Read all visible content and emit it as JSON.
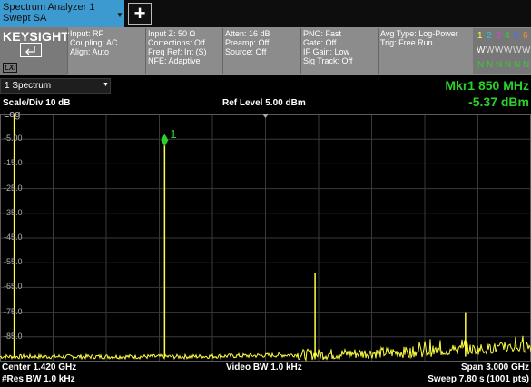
{
  "tabs": {
    "active_line1": "Spectrum Analyzer 1",
    "active_line2": "Swept SA",
    "caret": "▼",
    "add_label": "+"
  },
  "brand": {
    "name": "KEYSIGHT",
    "lxi": "LXI"
  },
  "status_columns": [
    [
      "Input: RF",
      "Coupling: AC",
      "Align: Auto"
    ],
    [
      "Input Z: 50 Ω",
      "Corrections: Off",
      "Freq Ref: Int (S)",
      "NFE: Adaptive"
    ],
    [
      "Atten: 16 dB",
      "Preamp: Off",
      "Source: Off"
    ],
    [
      "PNO: Fast",
      "Gate: Off",
      "IF Gain: Low",
      "Sig Track: Off"
    ],
    [
      "Avg Type: Log-Power",
      "Trig: Free Run"
    ]
  ],
  "trace_indicator": {
    "numbers": [
      "1",
      "2",
      "3",
      "4",
      "5",
      "6"
    ],
    "types": [
      "W",
      "W",
      "W",
      "W",
      "W",
      "W"
    ],
    "detectors": [
      "N",
      "N",
      "N",
      "N",
      "N",
      "N"
    ]
  },
  "window": {
    "selector": "1 Spectrum",
    "caret": "▼"
  },
  "display": {
    "scale_div": "Scale/Div 10 dB",
    "scale_type": "Log",
    "ref_level": "Ref Level 5.00 dBm",
    "y_ticks": [
      "-5.00",
      "-15.0",
      "-25.0",
      "-35.0",
      "-45.0",
      "-55.0",
      "-65.0",
      "-75.0",
      "-85.0"
    ]
  },
  "marker": {
    "label": "Mkr1  850 MHz",
    "value": "-5.37 dBm",
    "tag": "1"
  },
  "footer": {
    "center": "Center 1.420 GHz",
    "res_bw": "#Res BW 1.0 kHz",
    "video_bw": "Video BW 1.0 kHz",
    "span": "Span 3.000 GHz",
    "sweep": "Sweep 7.80 s (1001 pts)"
  },
  "colors": {
    "trace": "#ffff40",
    "marker": "#2bd02b",
    "grid": "#3a3a3a",
    "accent": "#3d9ad0"
  },
  "chart_data": {
    "type": "line",
    "x_unit": "GHz",
    "y_unit": "dBm",
    "xlim": [
      -0.08,
      2.92
    ],
    "ylim": [
      -95,
      5
    ],
    "grid": true,
    "peaks": [
      {
        "x": 0.0,
        "y": 5
      },
      {
        "x": 0.85,
        "y": -5.37
      },
      {
        "x": 1.7,
        "y": -59
      },
      {
        "x": 2.55,
        "y": -75
      }
    ],
    "noise_floor": [
      {
        "x": 0.0,
        "y": -93
      },
      {
        "x": 1.0,
        "y": -93
      },
      {
        "x": 1.8,
        "y": -92
      },
      {
        "x": 2.3,
        "y": -91
      },
      {
        "x": 2.92,
        "y": -89
      }
    ]
  }
}
